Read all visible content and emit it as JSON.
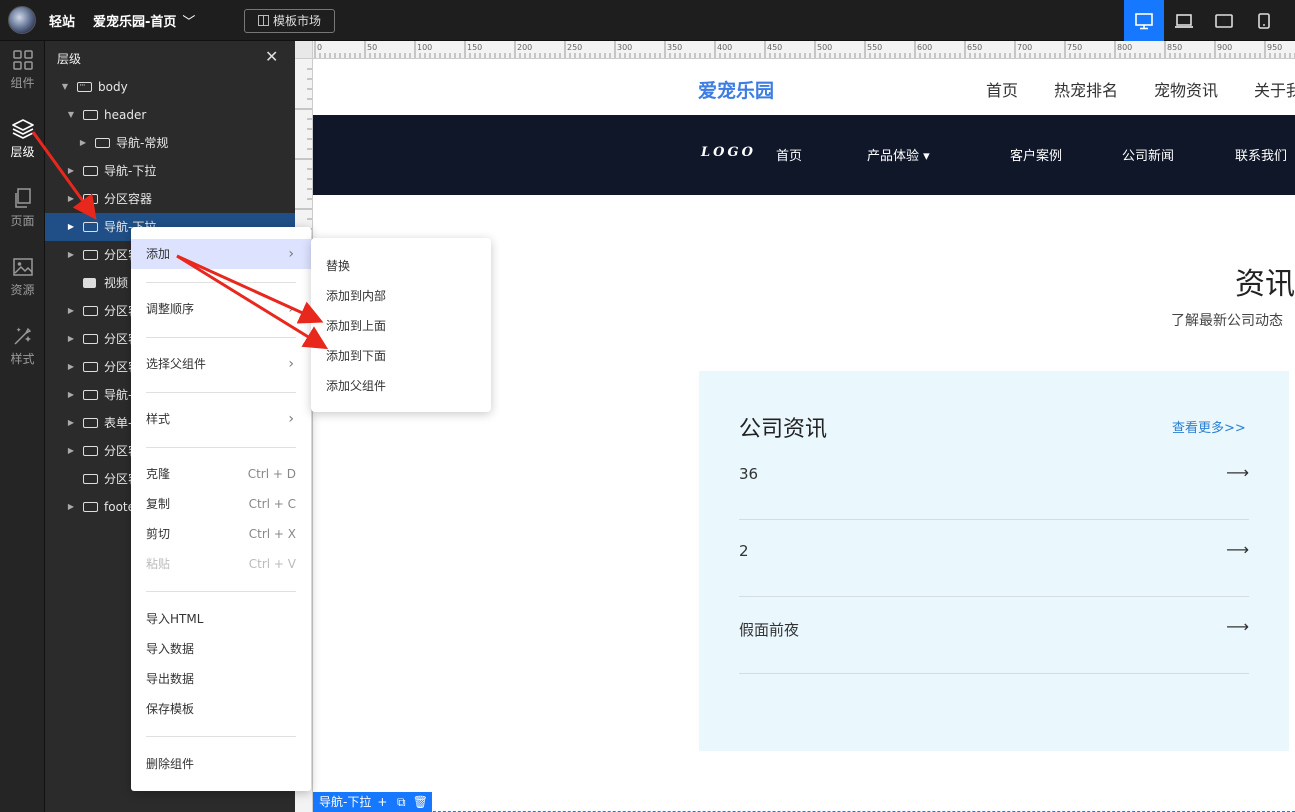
{
  "topbar": {
    "brand": "轻站",
    "site_name": "爱宠乐园-首页",
    "template_market": "模板市场",
    "devices": [
      "desktop-icon",
      "laptop-icon",
      "tablet-icon",
      "mobile-icon"
    ],
    "accent": "#1677ff"
  },
  "rail": [
    {
      "label": "组件",
      "icon": "grid-icon"
    },
    {
      "label": "层级",
      "icon": "layers-icon"
    },
    {
      "label": "页面",
      "icon": "pages-icon"
    },
    {
      "label": "资源",
      "icon": "image-icon"
    },
    {
      "label": "样式",
      "icon": "brush-icon"
    }
  ],
  "layers": {
    "title": "层级",
    "rows": [
      {
        "label": "body"
      },
      {
        "label": "header"
      },
      {
        "label": "导航-常规"
      },
      {
        "label": "导航-下拉"
      },
      {
        "label": "分区容器"
      },
      {
        "label": "导航-下拉"
      },
      {
        "label": "分区容器"
      },
      {
        "label": "视频"
      },
      {
        "label": "分区容器"
      },
      {
        "label": "分区容器"
      },
      {
        "label": "分区容器"
      },
      {
        "label": "导航-下拉"
      },
      {
        "label": "表单-常规"
      },
      {
        "label": "分区容器"
      },
      {
        "label": "分区容器"
      },
      {
        "label": "footer"
      }
    ]
  },
  "context_menu": {
    "add": "添加",
    "reorder": "调整顺序",
    "select_parent": "选择父组件",
    "style": "样式",
    "clone": "克隆",
    "clone_sc": "Ctrl + D",
    "copy": "复制",
    "copy_sc": "Ctrl + C",
    "cut": "剪切",
    "cut_sc": "Ctrl + X",
    "paste": "粘贴",
    "paste_sc": "Ctrl + V",
    "import_html": "导入HTML",
    "import_data": "导入数据",
    "export_data": "导出数据",
    "save_template": "保存模板",
    "delete": "删除组件"
  },
  "submenu": [
    "替换",
    "添加到内部",
    "添加到上面",
    "添加到下面",
    "添加父组件"
  ],
  "canvas": {
    "logo_text": "爱宠乐园",
    "top_nav": [
      "首页",
      "热宠排名",
      "宠物资讯",
      "关于我"
    ],
    "dark_logo": "LOGO",
    "dark_nav": [
      "首页",
      "产品体验 ▾",
      "客户案例",
      "公司新闻",
      "联系我们"
    ],
    "section_title": "资讯",
    "section_sub": "了解最新公司动态",
    "news_title": "公司资讯",
    "news_more": "查看更多>>",
    "news_items": [
      "36",
      "2",
      "假面前夜"
    ],
    "selected_tag": "导航-下拉"
  },
  "ruler": {
    "labels": [
      "0",
      "50",
      "100",
      "150",
      "200",
      "250",
      "300",
      "350",
      "400",
      "450",
      "500",
      "550",
      "600",
      "650",
      "700",
      "750",
      "800",
      "850",
      "900",
      "950"
    ]
  }
}
